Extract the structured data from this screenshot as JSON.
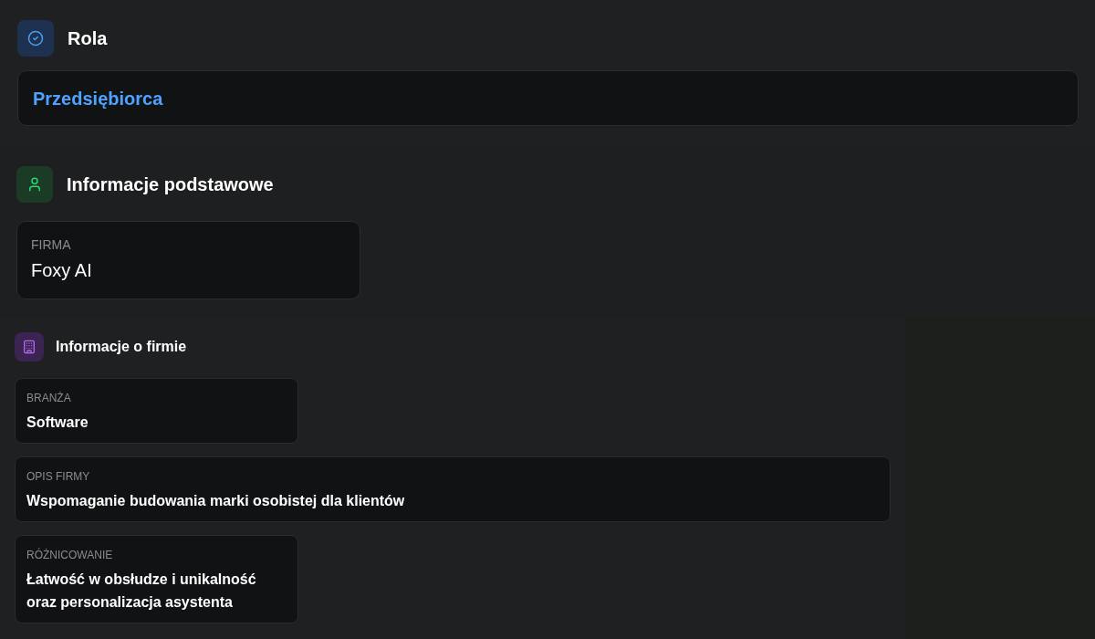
{
  "role_section": {
    "title": "Rola",
    "value": "Przedsiębiorca"
  },
  "basic_info": {
    "title": "Informacje podstawowe",
    "fields": [
      {
        "label": "FIRMA",
        "value": "Foxy AI"
      }
    ]
  },
  "company_info": {
    "title": "Informacje o firmie",
    "fields": [
      {
        "kind": "narrow",
        "label": "BRANŻA",
        "value": "Software"
      },
      {
        "kind": "wide",
        "label": "OPIS FIRMY",
        "value": "Wspomaganie budowania marki osobistej dla klientów"
      },
      {
        "kind": "narrow",
        "label": "RÓŻNICOWANIE",
        "value": "Łatwość w obsłudze i unikalność oraz personalizacja asystenta"
      }
    ]
  }
}
